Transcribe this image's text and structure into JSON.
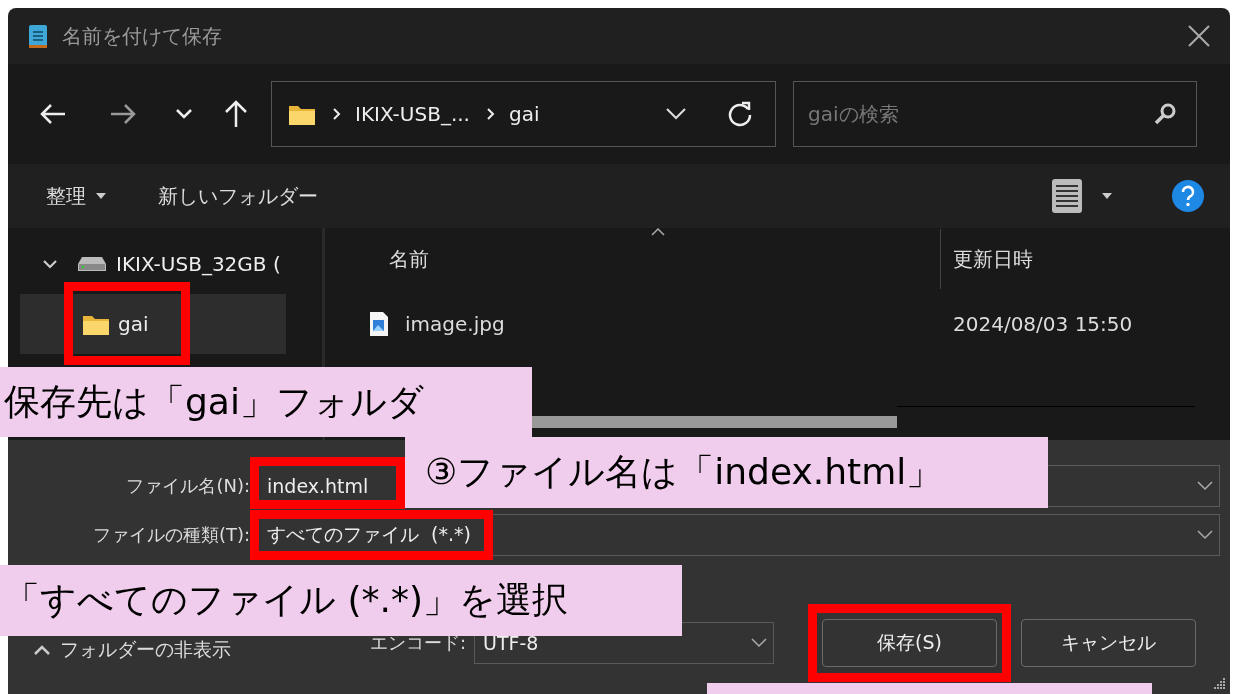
{
  "window": {
    "title": "名前を付けて保存"
  },
  "address_bar": {
    "segments": [
      "IKIX-USB_...",
      "gai"
    ]
  },
  "search": {
    "placeholder": "gaiの検索"
  },
  "toolbar": {
    "organize": "整理",
    "new_folder": "新しいフォルダー"
  },
  "sidebar": {
    "items": [
      {
        "label": "IKIX-USB_32GB (",
        "expanded": true,
        "selected": false,
        "highlighted": false,
        "children": [
          {
            "label": "gai",
            "selected": true,
            "highlighted": true
          }
        ]
      }
    ]
  },
  "file_list": {
    "columns": [
      {
        "label": "名前",
        "sorted": true
      },
      {
        "label": "更新日時",
        "sorted": false
      }
    ],
    "rows": [
      {
        "name": "image.jpg",
        "modified": "2024/08/03 15:50"
      }
    ]
  },
  "form": {
    "file_name": {
      "label": "ファイル名(N):",
      "value": "index.html",
      "highlighted": true
    },
    "file_type": {
      "label": "ファイルの種類(T):",
      "value": "すべてのファイル  (*.*)",
      "highlighted": true
    },
    "encoding": {
      "label": "エンコード:",
      "value": "UTF-8"
    }
  },
  "hide_folders": "フォルダーの非表示",
  "buttons": [
    {
      "label": "保存(S)",
      "highlighted": true
    },
    {
      "label": "キャンセル",
      "highlighted": false
    }
  ],
  "callouts": [
    {
      "kind": "text",
      "text": "保存先は「gai」フォルダ"
    },
    {
      "kind": "text",
      "text": "③ファイル名は「index.html」"
    },
    {
      "kind": "text",
      "text": "「すべてのファイル (*.*)」を選択"
    },
    {
      "kind": "blank"
    }
  ]
}
